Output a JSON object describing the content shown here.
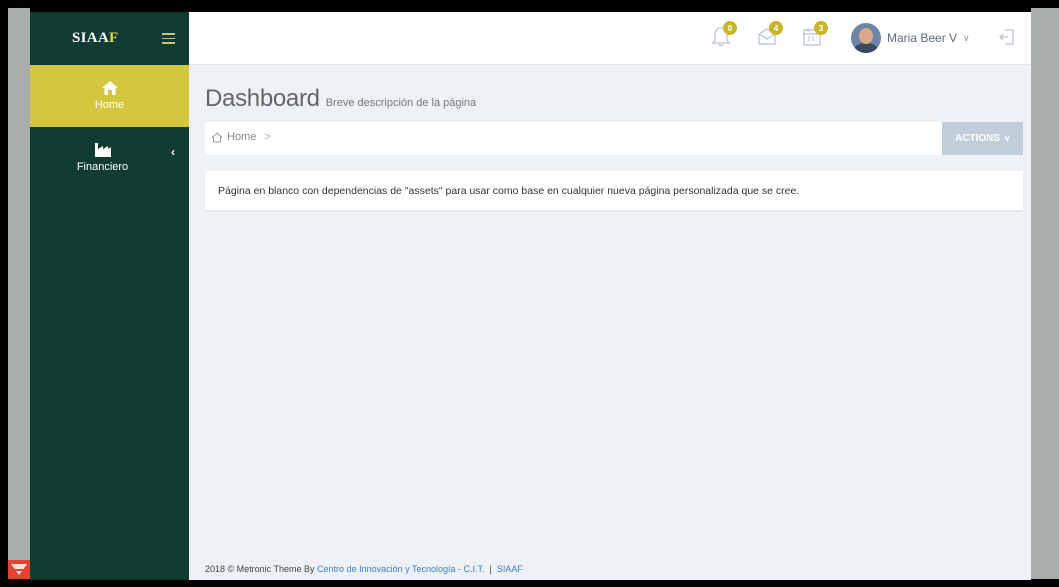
{
  "app": {
    "logo_main": "SIAA",
    "logo_accent": "F"
  },
  "sidebar": {
    "items": [
      {
        "label": "Home",
        "icon": "home-icon",
        "active": true
      },
      {
        "label": "Financiero",
        "icon": "factory-icon",
        "active": false
      }
    ]
  },
  "topbar": {
    "notifications_count": "0",
    "inbox_count": "4",
    "tasks_count": "3",
    "user_name": "Maria Beer V"
  },
  "page": {
    "title": "Dashboard",
    "subtitle": "Breve descripción de la página"
  },
  "breadcrumb": {
    "home": "Home",
    "separator": ">"
  },
  "actions_label": "ACTIONS",
  "note": "Página en blanco con dependencias de \"assets\" para usar como base en cualquier nueva página personalizada que se cree.",
  "footer": {
    "prefix": "2018 © Metronic Theme By",
    "link": "Centro de Innovación y Tecnología - C.I.T.",
    "divider": "|",
    "suffix": "SIAAF"
  },
  "colors": {
    "sidebar": "#0f3b30",
    "accent": "#d4c63f",
    "badge": "#c7b626",
    "content_bg": "#eef1f5",
    "actions_bg": "#c3cedb"
  }
}
